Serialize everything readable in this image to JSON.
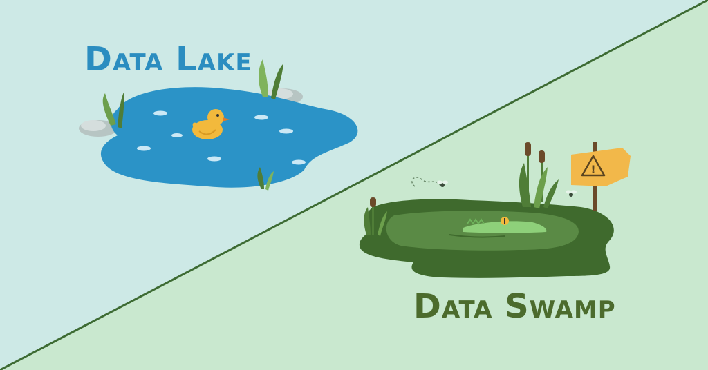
{
  "lake": {
    "title": "Data Lake",
    "title_color": "#2b8dc0",
    "water_color": "#2b93c7",
    "duck_color": "#f2b93c",
    "rock_color": "#c9d3d2",
    "reed_color": "#6c9f4c",
    "background": "#cde9e6"
  },
  "swamp": {
    "title": "Data Swamp",
    "title_color": "#4c6b2d",
    "water_color": "#3f6a2d",
    "inner_water_color": "#5a8a45",
    "croc_color": "#8ed07a",
    "sign_color": "#f2b84a",
    "sign_symbol": "!",
    "background": "#c9e8cf"
  },
  "divider_color": "#3d6b33",
  "icons": [
    "duck-icon",
    "warning-sign-icon",
    "crocodile-icon",
    "fly-icon",
    "reed-icon",
    "rock-icon"
  ]
}
